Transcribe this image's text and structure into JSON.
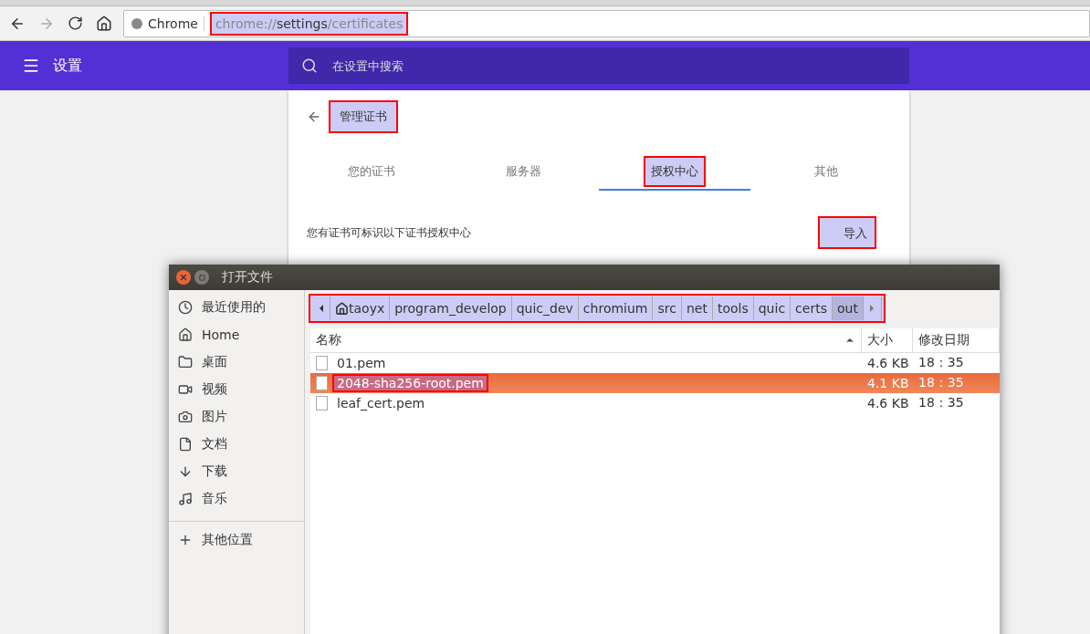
{
  "browser": {
    "site_label": "Chrome",
    "url_highlighted": true,
    "url": [
      {
        "text": "chrome://",
        "strong": false
      },
      {
        "text": "settings",
        "strong": true
      },
      {
        "text": "/certificates",
        "strong": false
      }
    ]
  },
  "header": {
    "title": "设置",
    "search_placeholder": "在设置中搜索"
  },
  "page": {
    "title": "管理证书",
    "title_highlighted": true,
    "tabs": [
      {
        "label": "您的证书",
        "selected": false,
        "highlighted": false
      },
      {
        "label": "服务器",
        "selected": false,
        "highlighted": false
      },
      {
        "label": "授权中心",
        "selected": true,
        "highlighted": true
      },
      {
        "label": "其他",
        "selected": false,
        "highlighted": false
      }
    ],
    "description": "您有证书可标识以下证书授权中心",
    "import_button": {
      "label": "导入",
      "highlighted": true
    }
  },
  "dialog": {
    "title": "打开文件",
    "places": [
      {
        "kind": "recent",
        "label": "最近使用的"
      },
      {
        "kind": "home",
        "label": "Home"
      },
      {
        "kind": "desktop",
        "label": "桌面"
      },
      {
        "kind": "videos",
        "label": "视频"
      },
      {
        "kind": "pictures",
        "label": "图片"
      },
      {
        "kind": "documents",
        "label": "文档"
      },
      {
        "kind": "downloads",
        "label": "下载"
      },
      {
        "kind": "music",
        "label": "音乐"
      }
    ],
    "other_places": "其他位置",
    "path_highlighted": true,
    "path": [
      {
        "label": "taoyx",
        "kind": "home",
        "selected": false
      },
      {
        "label": "program_develop",
        "kind": "folder",
        "selected": false
      },
      {
        "label": "quic_dev",
        "kind": "folder",
        "selected": false
      },
      {
        "label": "chromium",
        "kind": "folder",
        "selected": false
      },
      {
        "label": "src",
        "kind": "folder",
        "selected": false
      },
      {
        "label": "net",
        "kind": "folder",
        "selected": false
      },
      {
        "label": "tools",
        "kind": "folder",
        "selected": false
      },
      {
        "label": "quic",
        "kind": "folder",
        "selected": false
      },
      {
        "label": "certs",
        "kind": "folder",
        "selected": false
      },
      {
        "label": "out",
        "kind": "folder",
        "selected": true
      }
    ],
    "columns": [
      "名称",
      "大小",
      "修改日期"
    ],
    "files": [
      {
        "name": "01.pem",
        "size": "4.6 KB",
        "modified": "18：35",
        "selected": false,
        "highlighted": false
      },
      {
        "name": "2048-sha256-root.pem",
        "size": "4.1 KB",
        "modified": "18：35",
        "selected": true,
        "highlighted": true
      },
      {
        "name": "leaf_cert.pem",
        "size": "4.6 KB",
        "modified": "18：35",
        "selected": false,
        "highlighted": false
      }
    ]
  }
}
